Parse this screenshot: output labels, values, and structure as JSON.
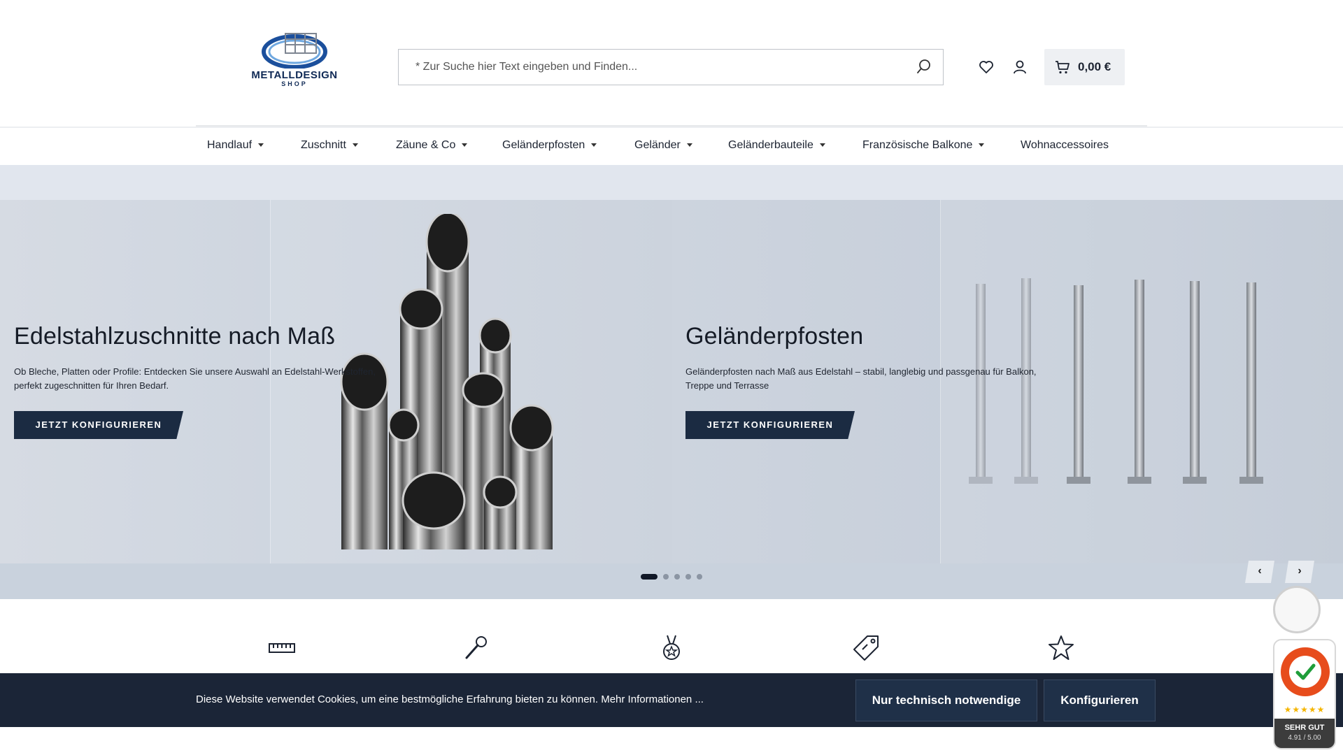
{
  "header": {
    "logo_text": "METALLDESIGN",
    "logo_sub": "SHOP",
    "search_placeholder": "* Zur Suche hier Text eingeben und Finden...",
    "cart_total": "0,00 €"
  },
  "nav": {
    "items": [
      {
        "label": "Handlauf",
        "has_dropdown": true
      },
      {
        "label": "Zuschnitt",
        "has_dropdown": true
      },
      {
        "label": "Zäune & Co",
        "has_dropdown": true
      },
      {
        "label": "Geländerpfosten",
        "has_dropdown": true
      },
      {
        "label": "Geländer",
        "has_dropdown": true
      },
      {
        "label": "Geländerbauteile",
        "has_dropdown": true
      },
      {
        "label": "Französische Balkone",
        "has_dropdown": true
      },
      {
        "label": "Wohnaccessoires",
        "has_dropdown": false
      }
    ]
  },
  "hero": {
    "slides": [
      {
        "title": "Edelstahlzuschnitte nach Maß",
        "text": "Ob Bleche, Platten oder Profile: Entdecken Sie unsere Auswahl an Edelstahl-Werkstoffen, perfekt zugeschnitten für Ihren Bedarf.",
        "cta": "JETZT KONFIGURIEREN"
      },
      {
        "title": "Geländerpfosten",
        "text": "Geländerpfosten nach Maß aus Edelstahl – stabil, langlebig und passgenau für Balkon, Treppe und Terrasse",
        "cta": "JETZT KONFIGURIEREN"
      }
    ],
    "dot_count": 5,
    "active_dot": 0,
    "prev_label": "‹",
    "next_label": "›"
  },
  "features": {
    "icons": [
      "ruler-icon",
      "wrench-icon",
      "medal-icon",
      "price-tag-icon",
      "star-icon"
    ]
  },
  "cookie": {
    "text": "Diese Website verwendet Cookies, um eine bestmögliche Erfahrung bieten zu können. Mehr Informationen ...",
    "btn_necessary": "Nur technisch notwendige",
    "btn_configure": "Konfigurieren"
  },
  "trust_badge": {
    "stars": "★★★★★",
    "rating": "SEHR GUT",
    "score": "4.91 / 5.00"
  },
  "colors": {
    "cta_bg": "#1b2b42",
    "cookie_bg": "#1b2537",
    "hero_bg": "#d7dde6"
  }
}
